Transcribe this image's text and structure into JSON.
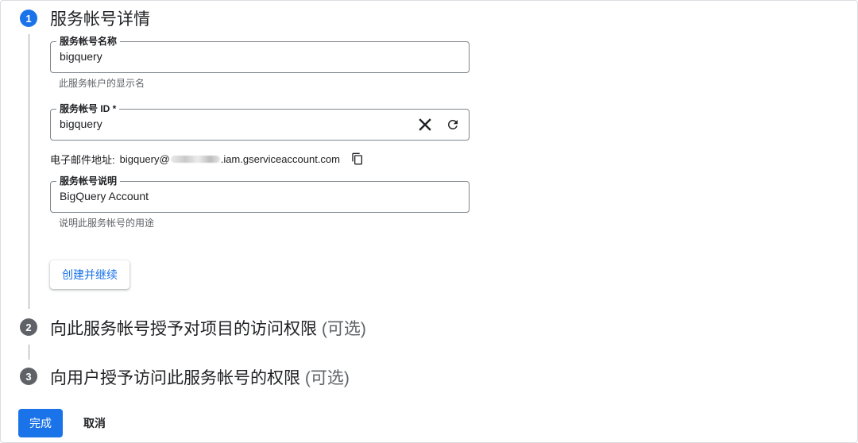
{
  "steps": [
    {
      "number": "1",
      "title": "服务帐号详情",
      "optional": ""
    },
    {
      "number": "2",
      "title": "向此服务帐号授予对项目的访问权限",
      "optional": "(可选)"
    },
    {
      "number": "3",
      "title": "向用户授予访问此服务帐号的权限",
      "optional": "(可选)"
    }
  ],
  "form": {
    "name": {
      "label": "服务帐号名称",
      "value": "bigquery",
      "hint": "此服务帐户的显示名"
    },
    "id": {
      "label": "服务帐号 ID *",
      "value": "bigquery"
    },
    "email": {
      "label": "电子邮件地址:",
      "prefix": "bigquery@",
      "suffix": ".iam.gserviceaccount.com"
    },
    "description": {
      "label": "服务帐号说明",
      "value": "BigQuery Account",
      "hint": "说明此服务帐号的用途"
    }
  },
  "buttons": {
    "create_continue": "创建并继续",
    "done": "完成",
    "cancel": "取消"
  },
  "icons": {
    "clear": "close-icon",
    "refresh": "refresh-icon",
    "copy": "copy-icon"
  },
  "colors": {
    "accent": "#1a73e8",
    "inactive_step": "#5f6368",
    "hint_text": "#5f6368"
  }
}
